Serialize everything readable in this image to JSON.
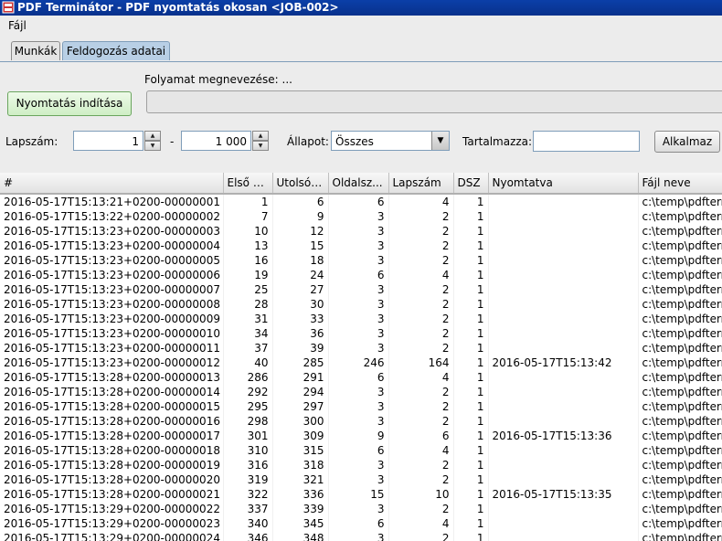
{
  "window": {
    "title": "PDF Terminátor - PDF nyomtatás okosan <JOB-002>"
  },
  "menu": {
    "file": "Fájl"
  },
  "tabs": [
    {
      "label": "Munkák"
    },
    {
      "label": "Feldogozás adatai"
    }
  ],
  "process": {
    "label": "Folyamat megnevezése: ...",
    "progress": 0
  },
  "print_button": "Nyomtatás indítása",
  "filters": {
    "page_label": "Lapszám:",
    "page_from": "1",
    "dash": "-",
    "page_to": "1 000",
    "state_label": "Állapot:",
    "state_value": "Összes",
    "contains_label": "Tartalmazza:",
    "contains_value": "",
    "apply_label": "Alkalmaz"
  },
  "table": {
    "columns": [
      "#",
      "Első o...",
      "Utolsó ...",
      "Oldalsz...",
      "Lapszám",
      "DSZ",
      "Nyomtatva",
      "Fájl neve"
    ],
    "rows": [
      [
        "2016-05-17T15:13:21+0200-00000001",
        "1",
        "6",
        "6",
        "4",
        "1",
        "",
        "c:\\temp\\pdfterm"
      ],
      [
        "2016-05-17T15:13:22+0200-00000002",
        "7",
        "9",
        "3",
        "2",
        "1",
        "",
        "c:\\temp\\pdfterm"
      ],
      [
        "2016-05-17T15:13:23+0200-00000003",
        "10",
        "12",
        "3",
        "2",
        "1",
        "",
        "c:\\temp\\pdfterm"
      ],
      [
        "2016-05-17T15:13:23+0200-00000004",
        "13",
        "15",
        "3",
        "2",
        "1",
        "",
        "c:\\temp\\pdfterm"
      ],
      [
        "2016-05-17T15:13:23+0200-00000005",
        "16",
        "18",
        "3",
        "2",
        "1",
        "",
        "c:\\temp\\pdfterm"
      ],
      [
        "2016-05-17T15:13:23+0200-00000006",
        "19",
        "24",
        "6",
        "4",
        "1",
        "",
        "c:\\temp\\pdfterm"
      ],
      [
        "2016-05-17T15:13:23+0200-00000007",
        "25",
        "27",
        "3",
        "2",
        "1",
        "",
        "c:\\temp\\pdfterm"
      ],
      [
        "2016-05-17T15:13:23+0200-00000008",
        "28",
        "30",
        "3",
        "2",
        "1",
        "",
        "c:\\temp\\pdfterm"
      ],
      [
        "2016-05-17T15:13:23+0200-00000009",
        "31",
        "33",
        "3",
        "2",
        "1",
        "",
        "c:\\temp\\pdfterm"
      ],
      [
        "2016-05-17T15:13:23+0200-00000010",
        "34",
        "36",
        "3",
        "2",
        "1",
        "",
        "c:\\temp\\pdfterm"
      ],
      [
        "2016-05-17T15:13:23+0200-00000011",
        "37",
        "39",
        "3",
        "2",
        "1",
        "",
        "c:\\temp\\pdfterm"
      ],
      [
        "2016-05-17T15:13:23+0200-00000012",
        "40",
        "285",
        "246",
        "164",
        "1",
        "2016-05-17T15:13:42",
        "c:\\temp\\pdfterm"
      ],
      [
        "2016-05-17T15:13:28+0200-00000013",
        "286",
        "291",
        "6",
        "4",
        "1",
        "",
        "c:\\temp\\pdfterm"
      ],
      [
        "2016-05-17T15:13:28+0200-00000014",
        "292",
        "294",
        "3",
        "2",
        "1",
        "",
        "c:\\temp\\pdfterm"
      ],
      [
        "2016-05-17T15:13:28+0200-00000015",
        "295",
        "297",
        "3",
        "2",
        "1",
        "",
        "c:\\temp\\pdfterm"
      ],
      [
        "2016-05-17T15:13:28+0200-00000016",
        "298",
        "300",
        "3",
        "2",
        "1",
        "",
        "c:\\temp\\pdfterm"
      ],
      [
        "2016-05-17T15:13:28+0200-00000017",
        "301",
        "309",
        "9",
        "6",
        "1",
        "2016-05-17T15:13:36",
        "c:\\temp\\pdfterm"
      ],
      [
        "2016-05-17T15:13:28+0200-00000018",
        "310",
        "315",
        "6",
        "4",
        "1",
        "",
        "c:\\temp\\pdfterm"
      ],
      [
        "2016-05-17T15:13:28+0200-00000019",
        "316",
        "318",
        "3",
        "2",
        "1",
        "",
        "c:\\temp\\pdfterm"
      ],
      [
        "2016-05-17T15:13:28+0200-00000020",
        "319",
        "321",
        "3",
        "2",
        "1",
        "",
        "c:\\temp\\pdfterm"
      ],
      [
        "2016-05-17T15:13:28+0200-00000021",
        "322",
        "336",
        "15",
        "10",
        "1",
        "2016-05-17T15:13:35",
        "c:\\temp\\pdfterm"
      ],
      [
        "2016-05-17T15:13:29+0200-00000022",
        "337",
        "339",
        "3",
        "2",
        "1",
        "",
        "c:\\temp\\pdfterm"
      ],
      [
        "2016-05-17T15:13:29+0200-00000023",
        "340",
        "345",
        "6",
        "4",
        "1",
        "",
        "c:\\temp\\pdfterm"
      ],
      [
        "2016-05-17T15:13:29+0200-00000024",
        "346",
        "348",
        "3",
        "2",
        "1",
        "",
        "c:\\temp\\pdfterm"
      ]
    ]
  }
}
